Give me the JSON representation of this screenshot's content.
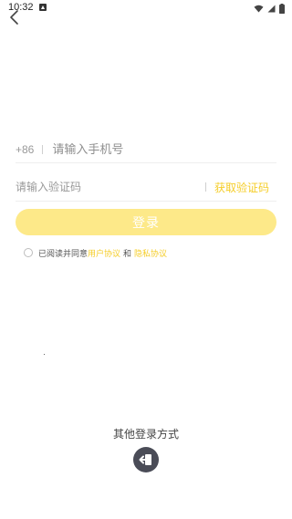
{
  "status_bar": {
    "time": "10:32",
    "icons": [
      "notification-icon",
      "wifi-icon",
      "signal-icon",
      "battery-icon"
    ]
  },
  "nav": {
    "back_icon": "chevron-left-icon"
  },
  "phone": {
    "country_code": "+86",
    "placeholder": "请输入手机号",
    "value": ""
  },
  "verification": {
    "placeholder": "请输入验证码",
    "value": "",
    "get_code_label": "获取验证码"
  },
  "login_button_label": "登录",
  "agreement": {
    "checked": false,
    "prefix": "已阅读并同意",
    "user_agreement": "用户协议",
    "and": "和",
    "privacy_policy": "隐私协议"
  },
  "other_login": {
    "title": "其他登录方式",
    "icon": "login-exit-icon"
  },
  "colors": {
    "accent": "#f5cd28",
    "login_button_bg": "#fde989",
    "other_login_bg": "#4a4c57"
  }
}
